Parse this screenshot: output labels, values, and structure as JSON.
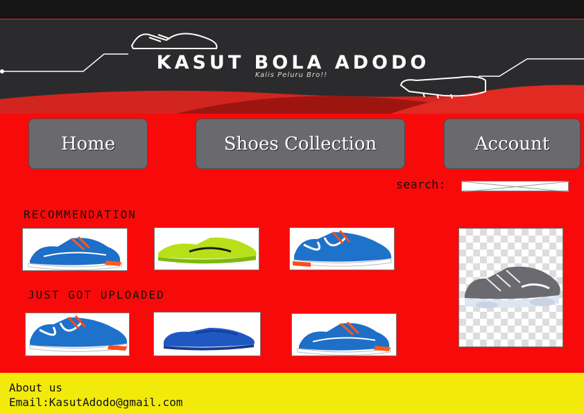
{
  "header": {
    "brand": "KASUT BOLA ADODO",
    "slogan": "Kalis Peluru Bro!!"
  },
  "nav": {
    "home_label": "Home",
    "collection_label": "Shoes Collection",
    "account_label": "Account"
  },
  "search": {
    "label": "search:",
    "value": ""
  },
  "sections": {
    "recommendation_title": "RECOMMENDATION",
    "uploaded_title": "JUST GOT UPLOADED"
  },
  "products": {
    "recommendation": [
      {
        "image": "blue-orange-running-shoe"
      },
      {
        "image": "lime-green-running-shoe"
      },
      {
        "image": "blue-white-running-shoe"
      }
    ],
    "uploaded": [
      {
        "image": "blue-white-running-shoe"
      },
      {
        "image": "blue-low-shoe"
      },
      {
        "image": "blue-orange-running-shoe"
      }
    ],
    "featured": {
      "image": "grey-knit-running-shoe"
    }
  },
  "footer": {
    "about": "About us",
    "email": "Email:KasutAdodo@gmail.com"
  },
  "colors": {
    "background_red": "#f90a0a",
    "banner_dark": "#2b2b2d",
    "nav_grey": "#6a6a6e",
    "footer_yellow": "#f2ea0b"
  }
}
